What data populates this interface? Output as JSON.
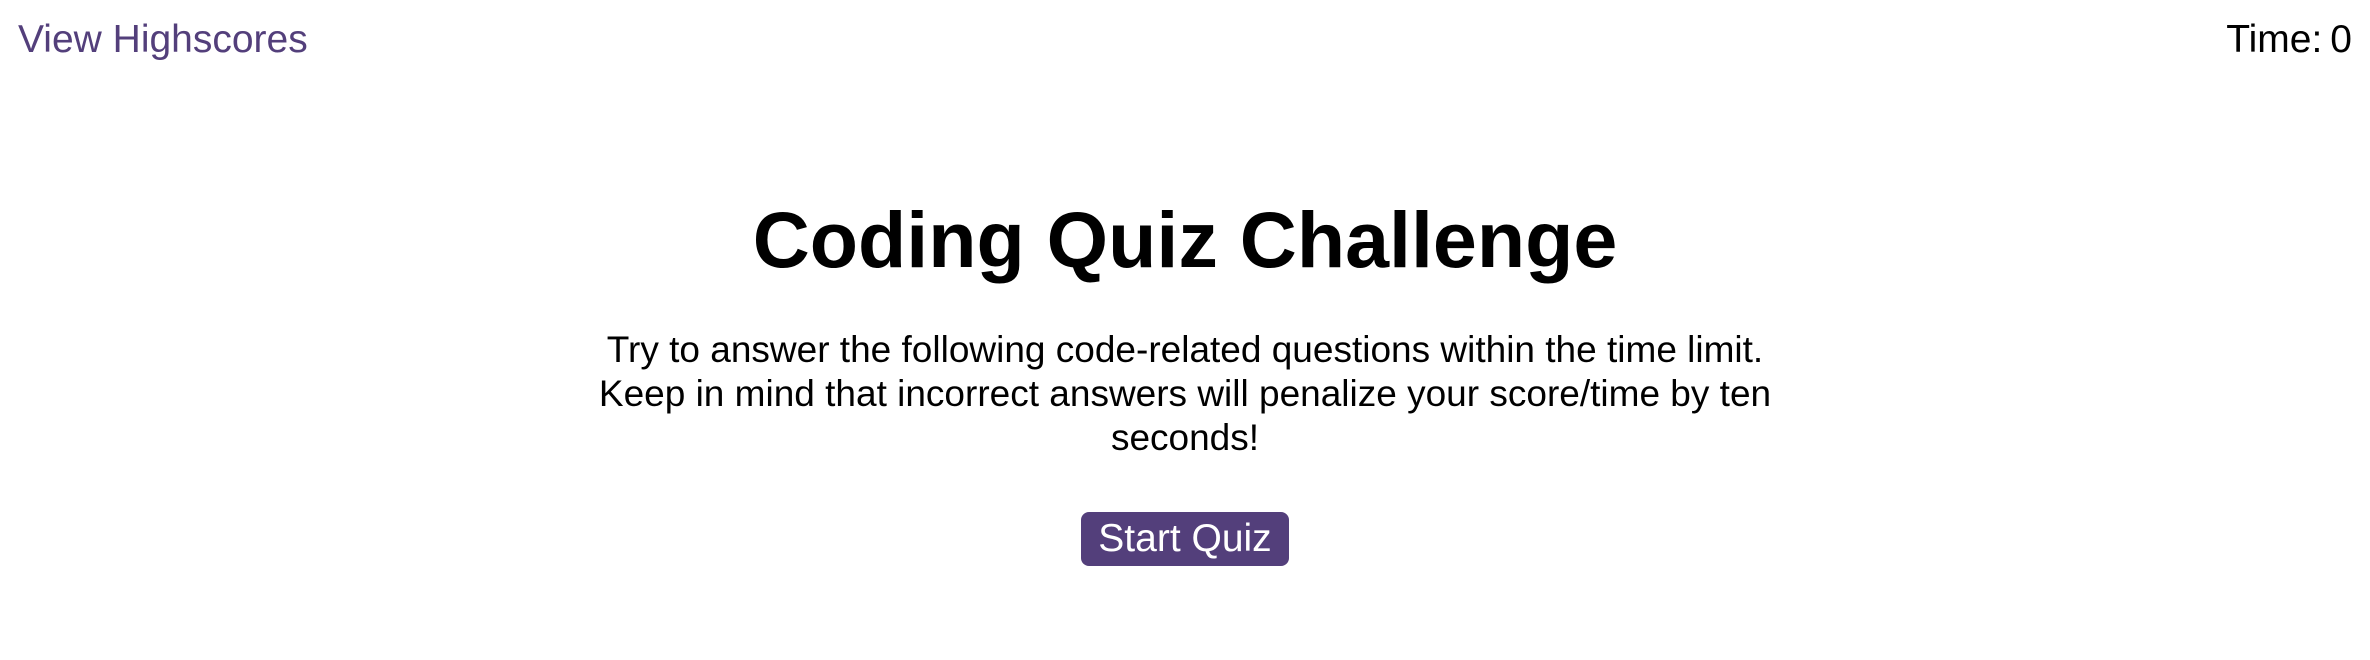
{
  "header": {
    "highscores_label": "View Highscores",
    "timer_label": "Time:",
    "timer_value": "0"
  },
  "main": {
    "title": "Coding Quiz Challenge",
    "description": "Try to answer the following code-related questions within the time limit. Keep in mind that incorrect answers will penalize your score/time by ten seconds!",
    "start_button_label": "Start Quiz"
  },
  "colors": {
    "accent": "#533f7b",
    "text": "#000000",
    "background": "#ffffff"
  }
}
